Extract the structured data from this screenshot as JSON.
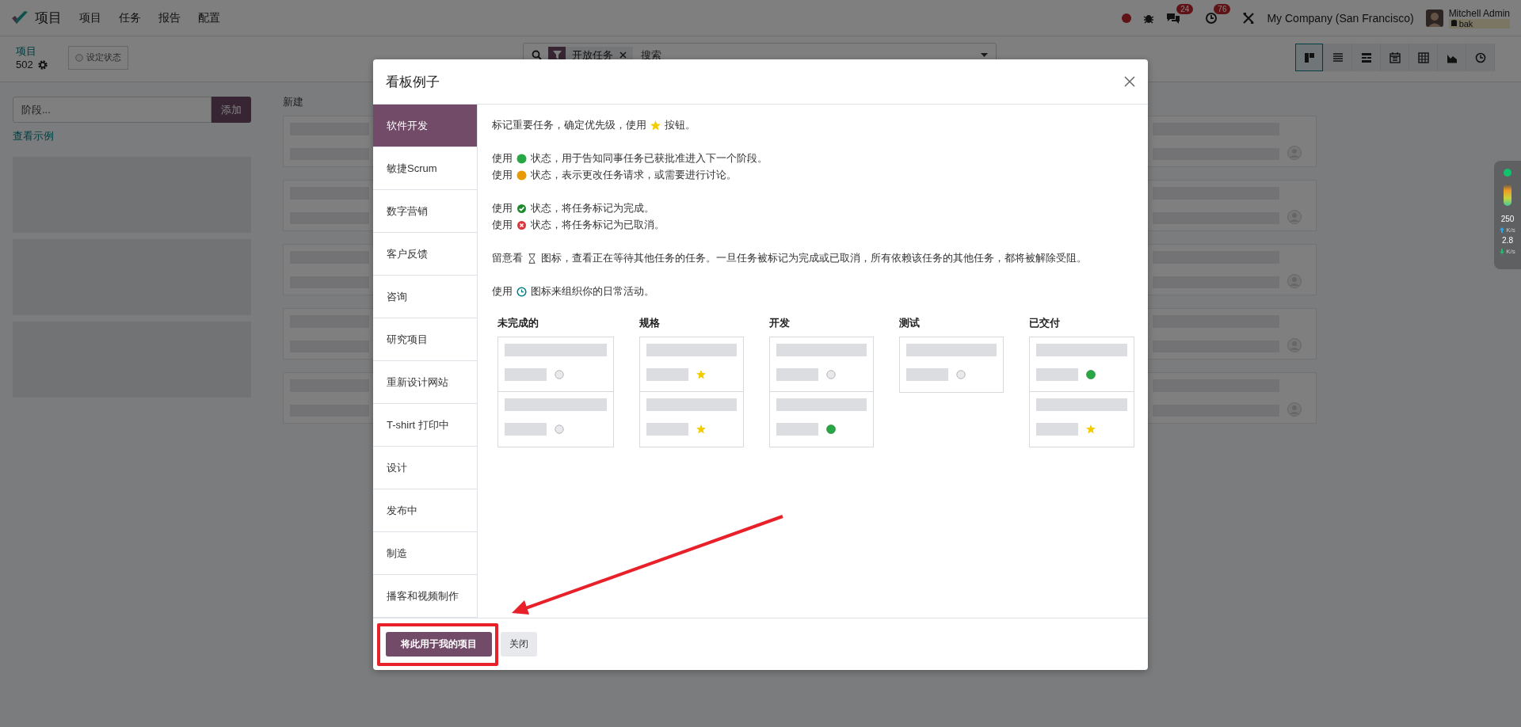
{
  "navbar": {
    "app": "项目",
    "menu": [
      "项目",
      "任务",
      "报告",
      "配置"
    ],
    "chat_count": "24",
    "activity_count": "76",
    "company": "My Company (San Francisco)",
    "user": "Mitchell Admin",
    "database": "bak"
  },
  "control_panel": {
    "breadcrumb": "项目",
    "record_count": "502",
    "status_button": "设定状态",
    "search": {
      "facet": "开放任务",
      "placeholder": "搜索"
    },
    "views": [
      {
        "kind": "kanban",
        "selected": true
      },
      {
        "kind": "list",
        "selected": false
      },
      {
        "kind": "gantt",
        "selected": false
      },
      {
        "kind": "calendar",
        "selected": false
      },
      {
        "kind": "pivot",
        "selected": false
      },
      {
        "kind": "graph",
        "selected": false
      },
      {
        "kind": "activity",
        "selected": false
      }
    ]
  },
  "stage_form": {
    "placeholder": "阶段...",
    "add_button": "添加",
    "examples_link": "查看示例"
  },
  "kanban": {
    "column": "新建"
  },
  "dialog": {
    "title": "看板例子",
    "tabs": [
      {
        "label": "软件开发",
        "selected": true
      },
      {
        "label": "敏捷Scrum",
        "selected": false
      },
      {
        "label": "数字营销",
        "selected": false
      },
      {
        "label": "客户反馈",
        "selected": false
      },
      {
        "label": "咨询",
        "selected": false
      },
      {
        "label": "研究项目",
        "selected": false
      },
      {
        "label": "重新设计网站",
        "selected": false
      },
      {
        "label": "T-shirt 打印中",
        "selected": false
      },
      {
        "label": "设计",
        "selected": false
      },
      {
        "label": "发布中",
        "selected": false
      },
      {
        "label": "制造",
        "selected": false
      },
      {
        "label": "播客和视频制作",
        "selected": false
      }
    ],
    "help": [
      [
        {
          "before": "标记重要任务，确定优先级，使用",
          "kind": "star",
          "after": "按钮。"
        }
      ],
      [
        {
          "before": "使用",
          "kind": "green",
          "after": "状态，用于告知同事任务已获批准进入下一个阶段。"
        },
        {
          "before": "使用",
          "kind": "orange",
          "after": "状态，表示更改任务请求，或需要进行讨论。"
        }
      ],
      [
        {
          "before": "使用",
          "kind": "done",
          "after": "状态，将任务标记为完成。"
        },
        {
          "before": "使用",
          "kind": "cancel",
          "after": "状态，将任务标记为已取消。"
        }
      ],
      [
        {
          "before": "留意看",
          "kind": "waiting",
          "after": "图标，查看正在等待其他任务的任务。一旦任务被标记为完成或已取消，所有依赖该任务的其他任务，都将被解除受阻。"
        }
      ],
      [
        {
          "before": "使用",
          "kind": "activity",
          "after": "图标来组织你的日常活动。"
        }
      ]
    ],
    "example": [
      {
        "title": "未完成的",
        "cards": [
          {
            "kind": "normal"
          },
          {
            "kind": "normal"
          }
        ]
      },
      {
        "title": "规格",
        "cards": [
          {
            "kind": "starred"
          },
          {
            "kind": "starred"
          }
        ]
      },
      {
        "title": "开发",
        "cards": [
          {
            "kind": "normal"
          },
          {
            "kind": "ready"
          }
        ]
      },
      {
        "title": "测试",
        "cards": [
          {
            "kind": "normal"
          }
        ]
      },
      {
        "title": "已交付",
        "cards": [
          {
            "kind": "ready"
          },
          {
            "kind": "starred"
          }
        ]
      }
    ],
    "buttons": [
      {
        "label": "将此用于我的项目",
        "kind": "primary"
      },
      {
        "label": "关闭",
        "kind": "secondary"
      }
    ]
  },
  "annotations": {
    "highlight_frame": true,
    "arrow": true
  },
  "speed_widget": {
    "upload": "250",
    "upload_unit": "K/s",
    "download": "2.8",
    "download_unit": "K/s"
  }
}
